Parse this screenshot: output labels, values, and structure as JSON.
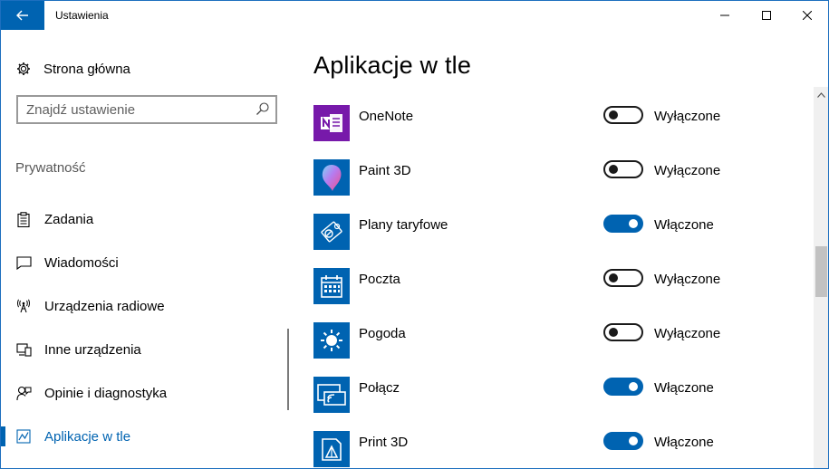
{
  "window": {
    "title": "Ustawienia"
  },
  "sidebar": {
    "home_label": "Strona główna",
    "search_placeholder": "Znajdź ustawienie",
    "section_title": "Prywatność",
    "items": [
      {
        "label": "Zadania",
        "icon": "clipboard-icon"
      },
      {
        "label": "Wiadomości",
        "icon": "message-icon"
      },
      {
        "label": "Urządzenia radiowe",
        "icon": "radio-tower-icon"
      },
      {
        "label": "Inne urządzenia",
        "icon": "devices-icon"
      },
      {
        "label": "Opinie i diagnostyka",
        "icon": "feedback-icon"
      },
      {
        "label": "Aplikacje w tle",
        "icon": "background-apps-icon",
        "active": true
      }
    ]
  },
  "main": {
    "title": "Aplikacje w tle",
    "apps": [
      {
        "name": "OneNote",
        "state": "Wyłączone",
        "on": false,
        "icon": "onenote-icon",
        "color": "#7719aa"
      },
      {
        "name": "Paint 3D",
        "state": "Wyłączone",
        "on": false,
        "icon": "paint3d-icon",
        "color": "#0063b1"
      },
      {
        "name": "Plany taryfowe",
        "state": "Włączone",
        "on": true,
        "icon": "data-plans-icon",
        "color": "#0063b1"
      },
      {
        "name": "Poczta",
        "state": "Wyłączone",
        "on": false,
        "icon": "mail-calendar-icon",
        "color": "#0063b1"
      },
      {
        "name": "Pogoda",
        "state": "Wyłączone",
        "on": false,
        "icon": "weather-icon",
        "color": "#0063b1"
      },
      {
        "name": "Połącz",
        "state": "Włączone",
        "on": true,
        "icon": "connect-icon",
        "color": "#0063b1"
      },
      {
        "name": "Print 3D",
        "state": "Włączone",
        "on": true,
        "icon": "print3d-icon",
        "color": "#0063b1"
      }
    ]
  },
  "colors": {
    "accent": "#0063b1",
    "onenote": "#7719aa"
  }
}
